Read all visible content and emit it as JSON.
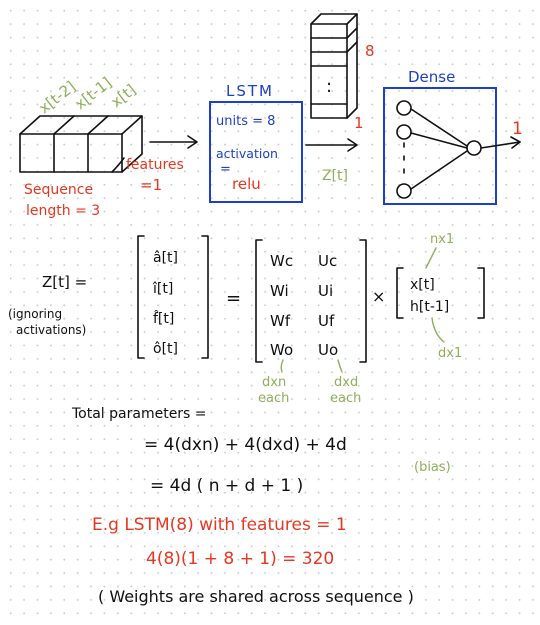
{
  "colors": {
    "ink": "#111111",
    "red": "#e8361f",
    "blue": "#1d3fc9",
    "green": "#8db05a",
    "dot_grid": "#c9ccd2"
  },
  "input": {
    "timestep_labels": [
      "x[t-2]",
      "x[t-1]",
      "x[t]"
    ],
    "features_label": "features",
    "features_value": "=1",
    "sequence_label": "Sequence",
    "length_label": "length = 3"
  },
  "lstm": {
    "title": "LSTM",
    "units": "units = 8",
    "activation_label": "activation",
    "activation_eq": "=",
    "activation_value": "relu"
  },
  "output_cube": {
    "dots": ":",
    "size_label": "8",
    "depth_label": "1",
    "z_label": "Z[t]"
  },
  "dense": {
    "title": "Dense",
    "output_value": "1"
  },
  "equation": {
    "lhs": "Z[t] =",
    "ignoring_line1": "(ignoring",
    "ignoring_line2": "activations)",
    "gates": [
      "â[t]",
      "î[t]",
      "f̂[t]",
      "ô[t]"
    ],
    "equals": "=",
    "weights": [
      [
        "Wc",
        "Uc"
      ],
      [
        "Wi",
        "Ui"
      ],
      [
        "Wf",
        "Uf"
      ],
      [
        "Wo",
        "Uo"
      ]
    ],
    "times": "×",
    "vector": [
      "x[t]",
      "h[t-1]"
    ],
    "nx1": "nx1",
    "dx1": "dx1",
    "dxn": "dxn",
    "dxd": "dxd",
    "each1": "each",
    "each2": "each"
  },
  "totals": {
    "title": "Total parameters =",
    "line1": "= 4(dxn) + 4(dxd) + 4d",
    "bias": "(bias)",
    "line2": "= 4d ( n + d + 1 )"
  },
  "example": {
    "line1": "E.g LSTM(8) with features = 1",
    "line2": "4(8)(1 + 8 + 1) = 320"
  },
  "footer": "( Weights are shared across sequence )"
}
